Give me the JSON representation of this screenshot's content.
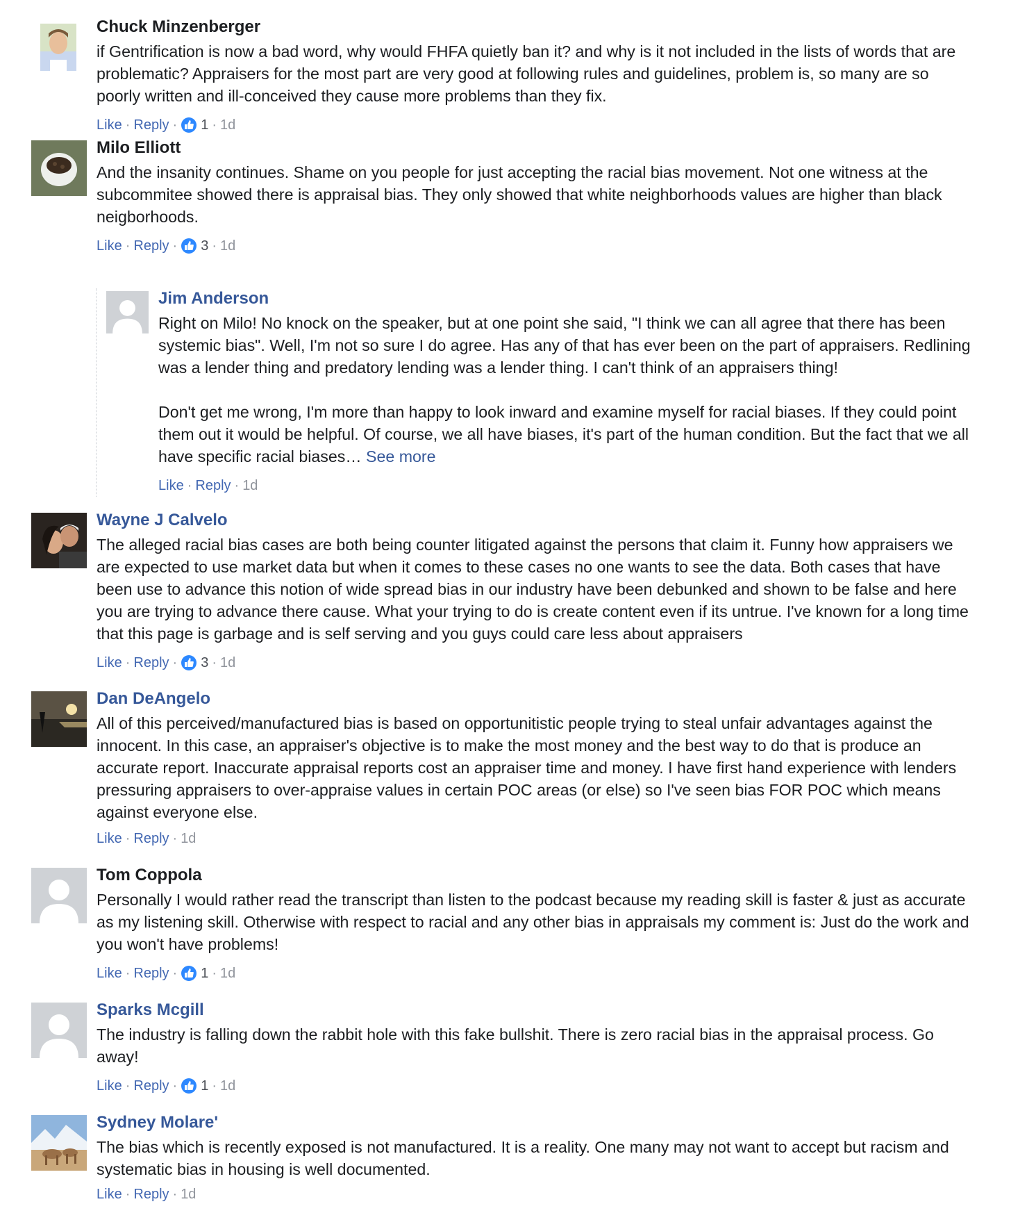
{
  "actions": {
    "like": "Like",
    "reply": "Reply",
    "separator": "·",
    "see_more": "See more",
    "like_icon": "thumbs-up-icon"
  },
  "comments": [
    {
      "author": "Chuck Minzenberger",
      "avatar": "photo",
      "text": "if Gentrification is now a bad word, why would FHFA quietly ban it? and why is it not included in the lists of words that are problematic? Appraisers for the most part are very good at following rules and guidelines, problem is, so many are so poorly written and ill-conceived they cause more problems than they fix.",
      "reactions": "1",
      "time": "1d"
    },
    {
      "author": "Milo Elliott",
      "avatar": "photo",
      "text": "And the insanity continues. Shame on you people for just accepting the racial bias movement. Not one witness at the subcommitee showed there is appraisal bias. They only showed that white neighborhoods values are higher than black neigborhoods.",
      "reactions": "3",
      "time": "1d"
    },
    {
      "author": "Jim Anderson",
      "avatar": "default",
      "text_p1": "Right on Milo! No knock on the speaker, but at one point she said, \"I think we can all agree that there has been systemic bias\". Well, I'm not so sure I do agree. Has any of that has ever been on the part of appraisers. Redlining was a lender thing and predatory lending was a lender thing. I can't think of an appraisers thing!",
      "text_p2": "Don't get me wrong, I'm more than happy to look inward and examine myself for racial biases. If they could point them out it would be helpful. Of course, we all have biases, it's part of the human condition. But the fact that we all have specific racial biases…",
      "time": "1d"
    },
    {
      "author": "Wayne J Calvelo",
      "avatar": "photo",
      "text": "The alleged racial bias cases are both being counter litigated against the persons that claim it. Funny how appraisers we are expected to use market data but when it comes to these cases no one wants to see the data. Both cases that have been use to advance this notion of wide spread bias in our industry have been debunked and shown to be false and here you are trying to advance there cause. What your trying to do is create content even if its untrue. I've known for a long time that this page is garbage and is self serving and you guys could care less about appraisers",
      "reactions": "3",
      "time": "1d"
    },
    {
      "author": "Dan DeAngelo",
      "avatar": "photo",
      "text": "All of this perceived/manufactured bias is based on opportunitistic people trying to steal unfair advantages against the innocent. In this case, an appraiser's objective is to make the most money and the best way to do that is produce an accurate report. Inaccurate appraisal reports cost an appraiser time and money. I have first hand experience with lenders pressuring appraisers to over-appraise values in certain POC areas (or else) so I've seen bias FOR POC which means against everyone else.",
      "time": "1d"
    },
    {
      "author": "Tom Coppola",
      "avatar": "default",
      "text": "Personally I would rather read the transcript than listen to the podcast because my reading skill is faster & just as accurate as my listening skill. Otherwise with respect to racial and any other bias in appraisals my comment is: Just do the work and you won't have problems!",
      "reactions": "1",
      "time": "1d"
    },
    {
      "author": "Sparks Mcgill",
      "avatar": "default",
      "text": "The industry is falling down the rabbit hole with this fake bullshit. There is zero racial bias in the appraisal process. Go away!",
      "reactions": "1",
      "time": "1d"
    },
    {
      "author": "Sydney Molare'",
      "avatar": "photo",
      "text": "The bias which is recently exposed is not manufactured. It is a reality. One many may not want to accept but racism and systematic bias in housing is well documented.",
      "time": "1d"
    }
  ]
}
